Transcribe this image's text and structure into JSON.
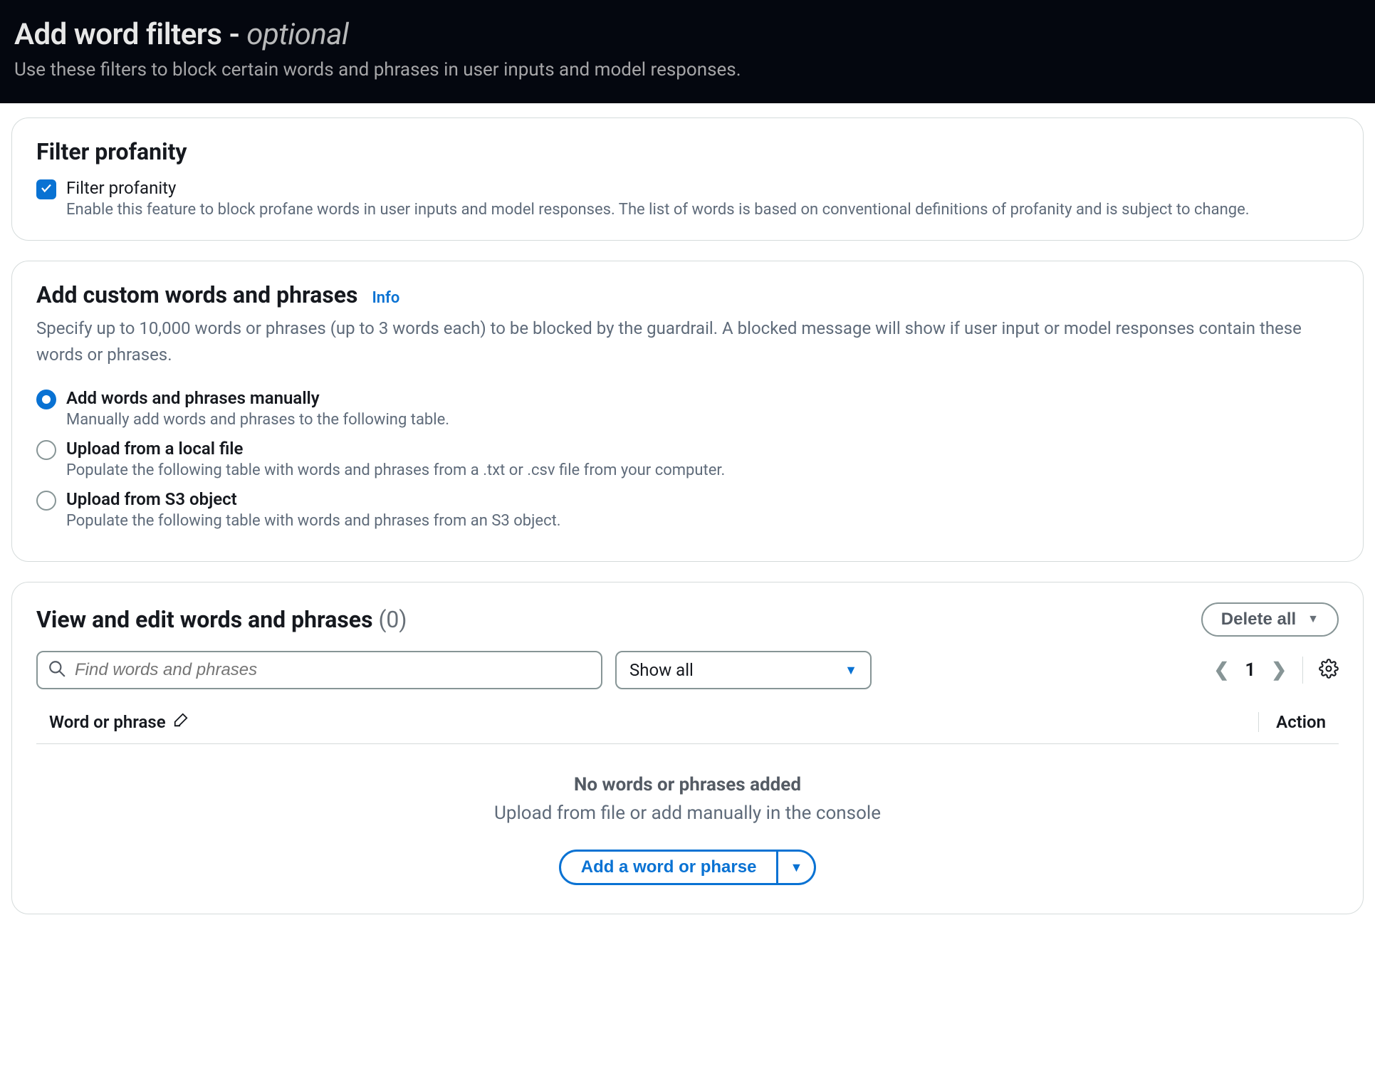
{
  "header": {
    "title_main": "Add word filters - ",
    "title_optional": "optional",
    "subtitle": "Use these filters to block certain words and phrases in user inputs and model responses."
  },
  "profanity_card": {
    "title": "Filter profanity",
    "checkbox_label": "Filter profanity",
    "checkbox_desc": "Enable this feature to block profane words in user inputs and model responses. The list of words is based on conventional definitions of profanity and is subject to change."
  },
  "custom_card": {
    "title": "Add custom words and phrases",
    "info": "Info",
    "desc": "Specify up to 10,000 words or phrases (up to 3 words each) to be blocked by the guardrail. A blocked message will show if user input or model responses contain these words or phrases.",
    "radios": [
      {
        "title": "Add words and phrases manually",
        "desc": "Manually add words and phrases to the following table.",
        "selected": true
      },
      {
        "title": "Upload from a local file",
        "desc": "Populate the following table with words and phrases from a .txt or .csv file from your computer.",
        "selected": false
      },
      {
        "title": "Upload from S3 object",
        "desc": "Populate the following table with words and phrases from an S3 object.",
        "selected": false
      }
    ]
  },
  "view_card": {
    "title": "View and edit words and phrases",
    "count": "(0)",
    "delete_all": "Delete all",
    "search_placeholder": "Find words and phrases",
    "select_value": "Show all",
    "page": "1",
    "col_word": "Word or phrase",
    "col_action": "Action",
    "empty_title": "No words or phrases added",
    "empty_desc": "Upload from file or add manually in the console",
    "add_button": "Add a word or pharse"
  }
}
